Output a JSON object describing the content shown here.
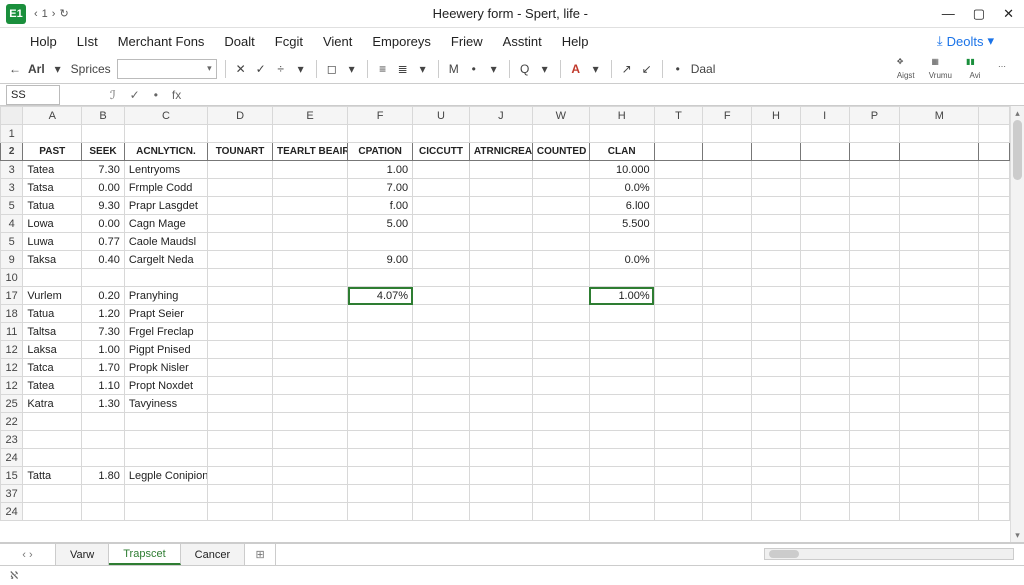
{
  "app": {
    "icon_text": "E1",
    "title": "Heewery form - Spert, life -"
  },
  "nav": {
    "back": "‹",
    "one": "1",
    "fwd": "›",
    "redo": "↻"
  },
  "winctrl": {
    "min": "—",
    "max": "▢",
    "close": "✕"
  },
  "menus": [
    "Holp",
    "LIst",
    "Merchant Fons",
    "Doalt",
    "Fcgit",
    "Vient",
    "Emporeys",
    "Friew",
    "Asstint",
    "Help"
  ],
  "right_menu": {
    "icon": "⤓",
    "label": "Deolts"
  },
  "toolbar": {
    "back": "←",
    "font_label": "Arl",
    "font_dd": "▾",
    "sprices": "Sprices",
    "fontbox_dd": "▾",
    "x": "✕",
    "check": "✓",
    "divide": "÷",
    "dd1": "▾",
    "box": "◻",
    "dd2": "▾",
    "alignL": "≡",
    "alignC": "≣",
    "dd3": "▾",
    "m": "M",
    "bullet": "•",
    "dd4": "▾",
    "q": "Q",
    "dd5": "▾",
    "a_color": "A",
    "dd6": "▾",
    "brush": "↗",
    "brush2": "↙",
    "dot": "•",
    "daal": "Daal"
  },
  "toolbar_right": [
    {
      "label": "Aigst"
    },
    {
      "label": "Vrumu"
    },
    {
      "label": "Avi"
    },
    {
      "label": ""
    }
  ],
  "namebox": "SS",
  "fx": {
    "italic": "ℐ",
    "check": "✓",
    "dot": "•",
    "fx": "fx"
  },
  "columns": [
    "",
    "A",
    "B",
    "C",
    "D",
    "E",
    "F",
    "U",
    "J",
    "W",
    "H",
    "T",
    "F",
    "H",
    "I",
    "P",
    "M",
    ""
  ],
  "header_row": {
    "A": "PAST",
    "B": "SEEK",
    "C": "ACNLYTICN.",
    "D": "TOUNART",
    "E": "TEARLT BEAIRY",
    "F": "CPATION",
    "U": "CICCUTT",
    "J": "ATRNICREAL FORMS",
    "W": "COUNTED",
    "H": "CLAN"
  },
  "rows": [
    {
      "n": "1"
    },
    {
      "n": "2",
      "hdr": true
    },
    {
      "n": "3",
      "A": "Tatea",
      "B": "7.30",
      "C": "Lentryoms",
      "F": "1.00",
      "H": "10.000"
    },
    {
      "n": "3",
      "A": "Tatsa",
      "B": "0.00",
      "C": "Frmple Codd",
      "F": "7.00",
      "H": "0.0%"
    },
    {
      "n": "5",
      "A": "Tatua",
      "B": "9.30",
      "C": "Prapr Lasgdet",
      "F": "f.00",
      "H": "6.l00"
    },
    {
      "n": "4",
      "A": "Lowa",
      "B": "0.00",
      "C": "Cagn Mage",
      "F": "5.00",
      "H": "5.500"
    },
    {
      "n": "5",
      "A": "Luwa",
      "B": "0.77",
      "C": "Caole Maudsl"
    },
    {
      "n": "9",
      "A": "Taksa",
      "B": "0.40",
      "C": "Cargelt Neda",
      "F": "9.00",
      "H": "0.0%"
    },
    {
      "n": "10"
    },
    {
      "n": "17",
      "A": "Vurlem",
      "B": "0.20",
      "C": "Pranyhing",
      "F": "4.07%",
      "H": "1.00%",
      "selF": true,
      "selH": true
    },
    {
      "n": "18",
      "A": "Tatua",
      "B": "1.20",
      "C": "Prapt Seier"
    },
    {
      "n": "11",
      "A": "Taltsa",
      "B": "7.30",
      "C": "Frgel Freclap"
    },
    {
      "n": "12",
      "A": "Laksa",
      "B": "1.00",
      "C": "Pigpt Pnised"
    },
    {
      "n": "12",
      "A": "Tatca",
      "B": "1.70",
      "C": "Propk Nisler"
    },
    {
      "n": "12",
      "A": "Tatea",
      "B": "1.10",
      "C": "Propt Noxdet"
    },
    {
      "n": "25",
      "A": "Katra",
      "B": "1.30",
      "C": "Tavyiness"
    },
    {
      "n": "22"
    },
    {
      "n": "23"
    },
    {
      "n": "24"
    },
    {
      "n": "15",
      "A": "Tatta",
      "B": "1.80",
      "C": "Legple Conipion"
    },
    {
      "n": "37"
    },
    {
      "n": "24"
    }
  ],
  "tabs": {
    "nav": "‹ ›",
    "items": [
      "Varw",
      "Trapscet",
      "Cancer"
    ],
    "active": 1,
    "add": "⊞"
  },
  "status": {
    "left": "ℵ"
  },
  "chart_data": {
    "type": "table",
    "columns": [
      "PAST",
      "SEEK",
      "ACNLYTICN.",
      "TOUNART",
      "TEARLT BEAIRY",
      "CPATION",
      "CICCUTT",
      "ATRNICREAL FORMS",
      "COUNTED",
      "CLAN"
    ],
    "rows": [
      [
        "Tatea",
        "7.30",
        "Lentryoms",
        "",
        "",
        "1.00",
        "",
        "",
        "",
        "10.000"
      ],
      [
        "Tatsa",
        "0.00",
        "Frmple Codd",
        "",
        "",
        "7.00",
        "",
        "",
        "",
        "0.0%"
      ],
      [
        "Tatua",
        "9.30",
        "Prapr Lasgdet",
        "",
        "",
        "f.00",
        "",
        "",
        "",
        "6.l00"
      ],
      [
        "Lowa",
        "0.00",
        "Cagn Mage",
        "",
        "",
        "5.00",
        "",
        "",
        "",
        "5.500"
      ],
      [
        "Luwa",
        "0.77",
        "Caole Maudsl",
        "",
        "",
        "",
        "",
        "",
        "",
        ""
      ],
      [
        "Taksa",
        "0.40",
        "Cargelt Neda",
        "",
        "",
        "9.00",
        "",
        "",
        "",
        "0.0%"
      ],
      [
        "Vurlem",
        "0.20",
        "Pranyhing",
        "",
        "",
        "4.07%",
        "",
        "",
        "",
        "1.00%"
      ],
      [
        "Tatua",
        "1.20",
        "Prapt Seier",
        "",
        "",
        "",
        "",
        "",
        "",
        ""
      ],
      [
        "Taltsa",
        "7.30",
        "Frgel Freclap",
        "",
        "",
        "",
        "",
        "",
        "",
        ""
      ],
      [
        "Laksa",
        "1.00",
        "Pigpt Pnised",
        "",
        "",
        "",
        "",
        "",
        "",
        ""
      ],
      [
        "Tatca",
        "1.70",
        "Propk Nisler",
        "",
        "",
        "",
        "",
        "",
        "",
        ""
      ],
      [
        "Tatea",
        "1.10",
        "Propt Noxdet",
        "",
        "",
        "",
        "",
        "",
        "",
        ""
      ],
      [
        "Katra",
        "1.30",
        "Tavyiness",
        "",
        "",
        "",
        "",
        "",
        "",
        ""
      ],
      [
        "Tatta",
        "1.80",
        "Legple Conipion",
        "",
        "",
        "",
        "",
        "",
        "",
        ""
      ]
    ]
  }
}
